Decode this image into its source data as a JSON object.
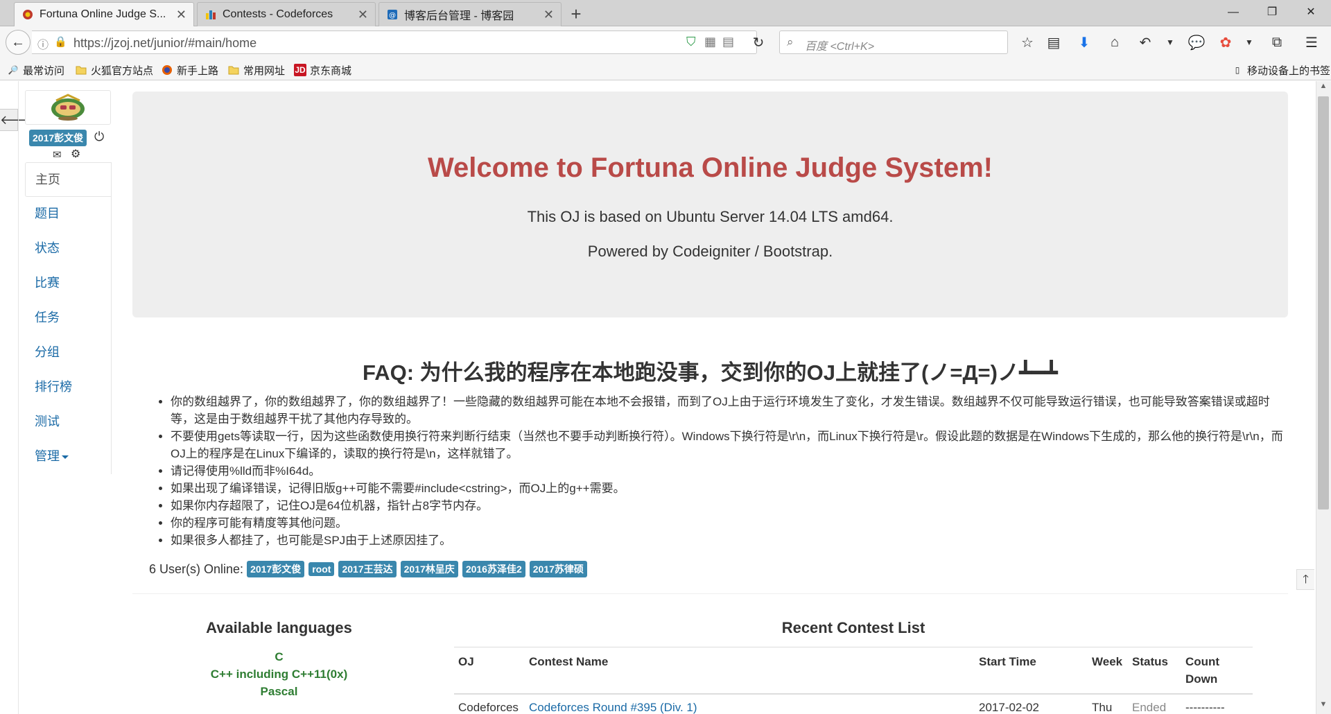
{
  "browser": {
    "tabs": [
      {
        "label": "Fortuna Online Judge S..."
      },
      {
        "label": "Contests - Codeforces"
      },
      {
        "label": "博客后台管理 - 博客园"
      }
    ],
    "url": "https://jzoj.net/junior/#main/home",
    "search_placeholder": "百度 <Ctrl+K>",
    "bookmarks": [
      {
        "label": "最常访问",
        "icon": "most-visited-icon"
      },
      {
        "label": "火狐官方站点",
        "icon": "folder-icon"
      },
      {
        "label": "新手上路",
        "icon": "firefox-icon"
      },
      {
        "label": "常用网址",
        "icon": "folder-icon"
      },
      {
        "label": "京东商城",
        "icon": "jd-icon"
      }
    ],
    "mobile_bookmarks": "移动设备上的书签",
    "colors": {
      "chrome": "#d3d3d3",
      "toolbar": "#f5f5f5",
      "download_arrow": "#1a73e8"
    }
  },
  "sidebar": {
    "username": "2017彭文俊",
    "items": [
      {
        "label": "主页",
        "active": true
      },
      {
        "label": "题目"
      },
      {
        "label": "状态"
      },
      {
        "label": "比赛"
      },
      {
        "label": "任务"
      },
      {
        "label": "分组"
      },
      {
        "label": "排行榜"
      },
      {
        "label": "测试"
      },
      {
        "label": "管理"
      }
    ]
  },
  "jumbotron": {
    "title": "Welcome to Fortuna Online Judge System!",
    "line1": "This OJ is based on Ubuntu Server 14.04 LTS amd64.",
    "line2": "Powered by Codeigniter / Bootstrap."
  },
  "faq": {
    "title": "FAQ: 为什么我的程序在本地跑没事，交到你的OJ上就挂了(ノ=Д=)ノ┻━┻",
    "items": [
      "你的数组越界了，你的数组越界了，你的数组越界了！一些隐藏的数组越界可能在本地不会报错，而到了OJ上由于运行环境发生了变化，才发生错误。数组越界不仅可能导致运行错误，也可能导致答案错误或超时等，这是由于数组越界干扰了其他内存导致的。",
      "不要使用gets等读取一行，因为这些函数使用换行符来判断行结束（当然也不要手动判断换行符）。Windows下换行符是\\r\\n，而Linux下换行符是\\r。假设此题的数据是在Windows下生成的，那么他的换行符是\\r\\n，而OJ上的程序是在Linux下编译的，读取的换行符是\\n，这样就错了。",
      "请记得使用%lld而非%I64d。",
      "如果出现了编译错误，记得旧版g++可能不需要#include<cstring>，而OJ上的g++需要。",
      "如果你内存超限了，记住OJ是64位机器，指针占8字节内存。",
      "你的程序可能有精度等其他问题。",
      "如果很多人都挂了，也可能是SPJ由于上述原因挂了。"
    ]
  },
  "online": {
    "label": "6 User(s) Online:",
    "users": [
      "2017彭文俊",
      "root",
      "2017王芸达",
      "2017林呈庆",
      "2016苏泽佳2",
      "2017苏律硕"
    ]
  },
  "languages": {
    "title": "Available languages",
    "items": [
      "C",
      "C++ including C++11(0x)",
      "Pascal"
    ]
  },
  "contests": {
    "title": "Recent Contest List",
    "headers": [
      "OJ",
      "Contest Name",
      "Start Time",
      "Week",
      "Status",
      "Count Down"
    ],
    "rows": [
      {
        "oj": "Codeforces",
        "name": "Codeforces Round #395 (Div. 1)",
        "start": "2017-02-02",
        "week": "Thu",
        "status": "Ended",
        "countdown": "----------"
      }
    ]
  },
  "colors": {
    "label_blue": "#3a87ad",
    "title_red": "#b94a48",
    "link_blue": "#1a6aa6",
    "language_green": "#2e7d32"
  }
}
